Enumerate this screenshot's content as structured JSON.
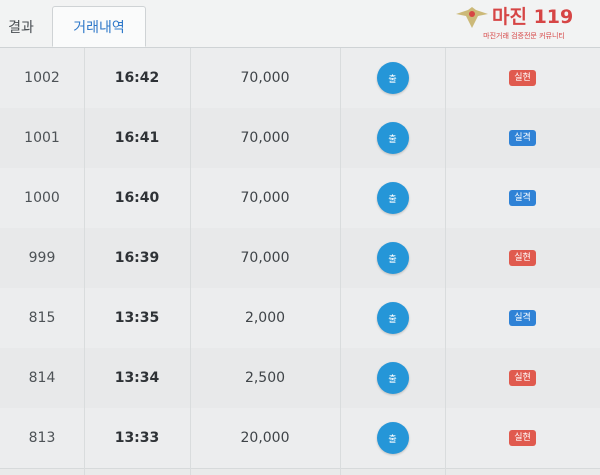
{
  "tabs": {
    "result_label": "결과",
    "trades_label": "거래내역"
  },
  "watermark": {
    "brand": "마진 119",
    "tagline": "마진거래 검증전문 커뮤니티"
  },
  "colors": {
    "accent_tab": "#2e78c9",
    "button_blue": "#2596d8",
    "badge_fail": "#e05a4e",
    "badge_win": "#2f82d6"
  },
  "rows": [
    {
      "no": "1002",
      "time": "16:42",
      "amount": "70,000",
      "button": "출",
      "result": "실현",
      "type": "red"
    },
    {
      "no": "1001",
      "time": "16:41",
      "amount": "70,000",
      "button": "출",
      "result": "실격",
      "type": "blue"
    },
    {
      "no": "1000",
      "time": "16:40",
      "amount": "70,000",
      "button": "출",
      "result": "실격",
      "type": "blue"
    },
    {
      "no": "999",
      "time": "16:39",
      "amount": "70,000",
      "button": "출",
      "result": "실현",
      "type": "red"
    },
    {
      "no": "815",
      "time": "13:35",
      "amount": "2,000",
      "button": "출",
      "result": "실격",
      "type": "blue"
    },
    {
      "no": "814",
      "time": "13:34",
      "amount": "2,500",
      "button": "출",
      "result": "실현",
      "type": "red"
    },
    {
      "no": "813",
      "time": "13:33",
      "amount": "20,000",
      "button": "출",
      "result": "실현",
      "type": "red"
    }
  ]
}
